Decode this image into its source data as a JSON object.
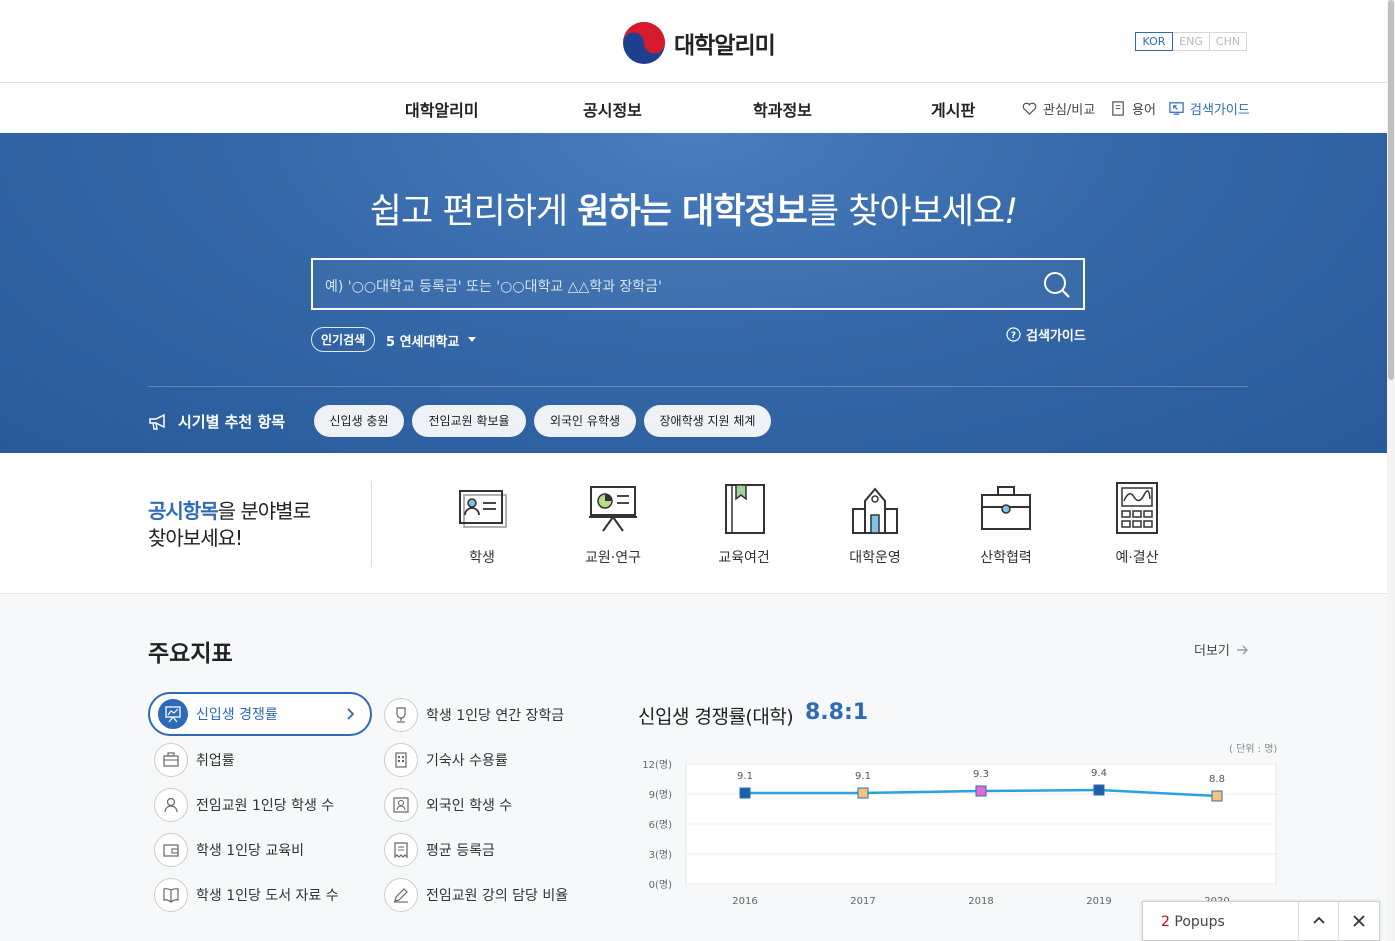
{
  "header": {
    "site_name": "대학알리미",
    "languages": [
      "KOR",
      "ENG",
      "CHN"
    ],
    "active_language": "KOR"
  },
  "gnb": {
    "menu": [
      "대학알리미",
      "공시정보",
      "학과정보",
      "게시판"
    ],
    "utils": [
      "관심/비교",
      "용어",
      "검색가이드"
    ]
  },
  "hero": {
    "title_pre": "쉽고 편리하게 ",
    "title_bold1": "원하는 대학정보",
    "title_post": "를 찾아보세요",
    "title_end": "!",
    "search_placeholder": "예) '○○대학교 등록금' 또는 '○○대학교 △△학과 장학금'",
    "popular_label": "인기검색",
    "popular_word": "5 연세대학교",
    "guide_label": "검색가이드",
    "season_label": "시기별 추천 항목",
    "chips": [
      "신입생 충원",
      "전임교원 확보율",
      "외국인 유학생",
      "장애학생 지원 체계"
    ]
  },
  "category": {
    "title_hl": "공시항목",
    "title_rest1": "을 분야별로",
    "title_line2": "찾아보세요!",
    "items": [
      "학생",
      "교원·연구",
      "교육여건",
      "대학운영",
      "산학협력",
      "예·결산"
    ]
  },
  "indicators": {
    "title": "주요지표",
    "more": "더보기",
    "left_items": [
      "신입생 경쟁률",
      "취업률",
      "전임교원 1인당 학생 수",
      "학생 1인당 교육비",
      "학생 1인당 도서 자료 수"
    ],
    "right_items": [
      "학생 1인당 연간 장학금",
      "기숙사 수용률",
      "외국인 학생 수",
      "평균 등록금",
      "전임교원 강의 담당 비율"
    ],
    "active": "신입생 경쟁률",
    "chart_title": "신입생 경쟁률(대학)",
    "chart_value": "8.8:1",
    "chart_unit": "( 단위 : 명)"
  },
  "chart_data": {
    "type": "line",
    "x": [
      "2016",
      "2017",
      "2018",
      "2019",
      "2020"
    ],
    "series": [
      {
        "values": [
          9.1,
          9.1,
          9.3,
          9.4,
          8.8
        ]
      }
    ],
    "yticks": [
      "0(명)",
      "3(명)",
      "6(명)",
      "9(명)",
      "12(명)"
    ],
    "ylim": [
      0,
      12
    ],
    "point_colors": [
      "#1c5fa8",
      "#f2c47c",
      "#e86ad0",
      "#1c5fa8",
      "#f2c47c"
    ],
    "line_color": "#29a3e0",
    "grid": true
  },
  "popups": {
    "count": "2",
    "label": "Popups"
  },
  "colors": {
    "accent": "#2d6bb8",
    "hero_bg": "#3568a8"
  }
}
